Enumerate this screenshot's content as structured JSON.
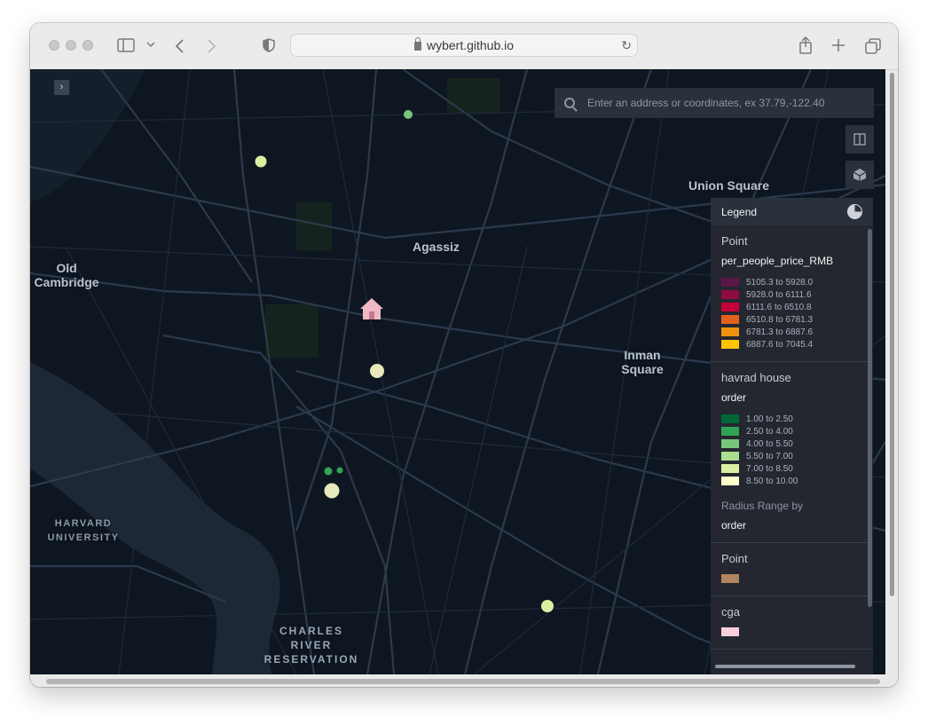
{
  "browser": {
    "url": "wybert.github.io"
  },
  "geocoder": {
    "placeholder": "Enter an address or coordinates, ex 37.79,-122.40"
  },
  "map_labels": {
    "union_square": "Union Square",
    "agassiz": "Agassiz",
    "old_cambridge_line1": "Old",
    "old_cambridge_line2": "Cambridge",
    "inman_line1": "Inman",
    "inman_line2": "Square",
    "harvard_line1": "HARVARD",
    "harvard_line2": "UNIVERSITY",
    "charles_line1": "CHARLES",
    "charles_line2": "RIVER",
    "charles_line3": "RESERVATION"
  },
  "legend": {
    "title": "Legend",
    "sections": [
      {
        "layer": "Point",
        "field": "per_people_price_RMB",
        "items": [
          {
            "label": "5105.3 to 5928.0",
            "color": "#5a1846"
          },
          {
            "label": "5928.0 to 6111.6",
            "color": "#900c3f"
          },
          {
            "label": "6111.6 to 6510.8",
            "color": "#c70039"
          },
          {
            "label": "6510.8 to 6781.3",
            "color": "#e3611c"
          },
          {
            "label": "6781.3 to 6887.6",
            "color": "#f1920e"
          },
          {
            "label": "6887.6 to 7045.4",
            "color": "#ffc300"
          }
        ]
      },
      {
        "layer": "havrad house",
        "field": "order",
        "items": [
          {
            "label": "1.00 to 2.50",
            "color": "#006837"
          },
          {
            "label": "2.50 to 4.00",
            "color": "#31a354"
          },
          {
            "label": "4.00 to 5.50",
            "color": "#78c679"
          },
          {
            "label": "5.50 to 7.00",
            "color": "#addd8e"
          },
          {
            "label": "7.00 to 8.50",
            "color": "#d9f0a3"
          },
          {
            "label": "8.50 to 10.00",
            "color": "#ffffcc"
          }
        ],
        "radius_label": "Radius Range by",
        "radius_field": "order"
      },
      {
        "layer": "Point",
        "color": "#b08560"
      },
      {
        "layer": "cga",
        "color": "#f7d0d9"
      }
    ]
  },
  "colors": {
    "map_bg": "#0e1621",
    "panel_bg": "#242730",
    "house_icon": "#f0b8c4"
  }
}
